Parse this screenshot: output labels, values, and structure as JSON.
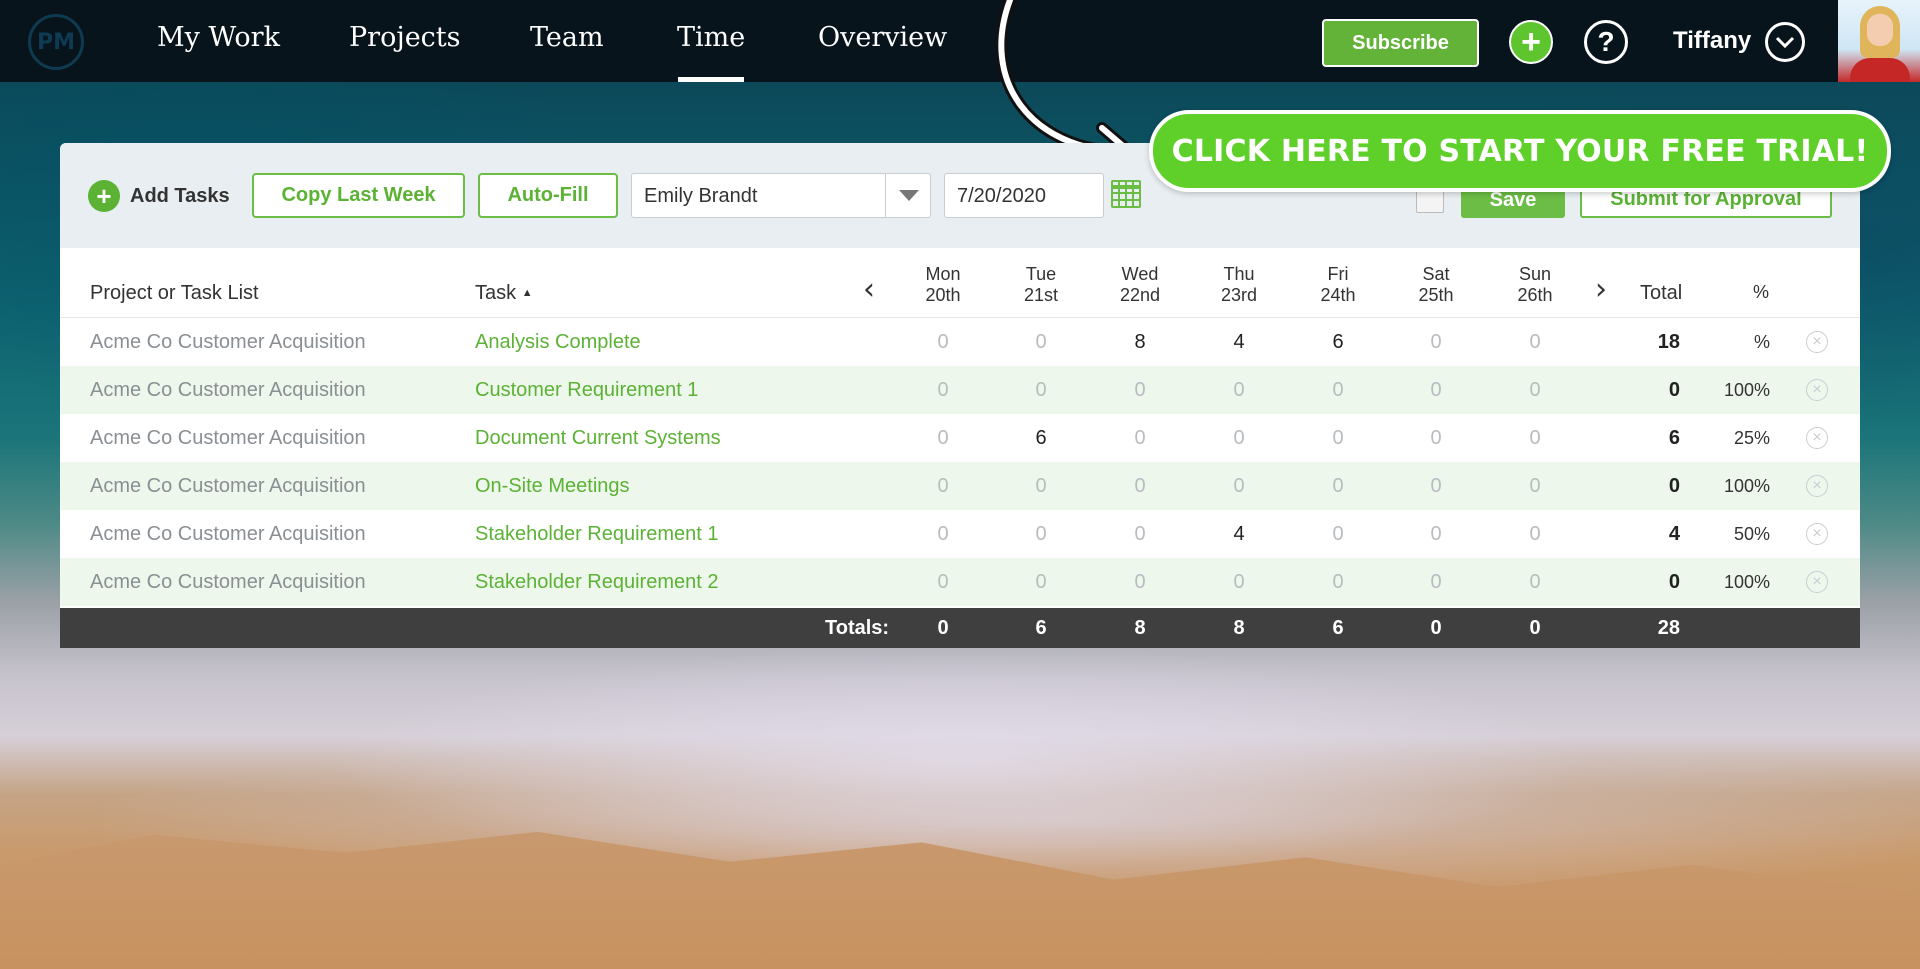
{
  "nav": {
    "logo": "PM",
    "links": [
      "My Work",
      "Projects",
      "Team",
      "Time",
      "Overview"
    ],
    "active": "Time",
    "subscribe": "Subscribe",
    "add_icon": "+",
    "help_icon": "?",
    "user": "Tiffany",
    "chevron": "⌄"
  },
  "cta": {
    "label": "CLICK HERE TO START YOUR FREE TRIAL!"
  },
  "toolbar": {
    "add_tasks": "Add Tasks",
    "add_plus": "+",
    "copy_last_week": "Copy Last Week",
    "auto_fill": "Auto-Fill",
    "person_select": "Emily Brandt",
    "date": "7/20/2020",
    "save": "Save",
    "submit": "Submit for Approval"
  },
  "table": {
    "headers": {
      "project": "Project or Task List",
      "task": "Task",
      "sort_icon": "▲",
      "prev": "‹",
      "next": "›",
      "total": "Total",
      "pct": "%"
    },
    "days": [
      {
        "dow": "Mon",
        "date": "20th"
      },
      {
        "dow": "Tue",
        "date": "21st"
      },
      {
        "dow": "Wed",
        "date": "22nd"
      },
      {
        "dow": "Thu",
        "date": "23rd"
      },
      {
        "dow": "Fri",
        "date": "24th"
      },
      {
        "dow": "Sat",
        "date": "25th"
      },
      {
        "dow": "Sun",
        "date": "26th"
      }
    ],
    "rows": [
      {
        "project": "Acme Co Customer Acquisition",
        "task": "Analysis Complete",
        "hours": [
          "0",
          "0",
          "8",
          "4",
          "6",
          "0",
          "0"
        ],
        "total": "18",
        "pct": "%"
      },
      {
        "project": "Acme Co Customer Acquisition",
        "task": "Customer Requirement 1",
        "hours": [
          "0",
          "0",
          "0",
          "0",
          "0",
          "0",
          "0"
        ],
        "total": "0",
        "pct": "100%"
      },
      {
        "project": "Acme Co Customer Acquisition",
        "task": "Document Current Systems",
        "hours": [
          "0",
          "6",
          "0",
          "0",
          "0",
          "0",
          "0"
        ],
        "total": "6",
        "pct": "25%"
      },
      {
        "project": "Acme Co Customer Acquisition",
        "task": "On-Site Meetings",
        "hours": [
          "0",
          "0",
          "0",
          "0",
          "0",
          "0",
          "0"
        ],
        "total": "0",
        "pct": "100%"
      },
      {
        "project": "Acme Co Customer Acquisition",
        "task": "Stakeholder Requirement 1",
        "hours": [
          "0",
          "0",
          "0",
          "4",
          "0",
          "0",
          "0"
        ],
        "total": "4",
        "pct": "50%"
      },
      {
        "project": "Acme Co Customer Acquisition",
        "task": "Stakeholder Requirement 2",
        "hours": [
          "0",
          "0",
          "0",
          "0",
          "0",
          "0",
          "0"
        ],
        "total": "0",
        "pct": "100%"
      }
    ],
    "delete_icon": "×",
    "totals": {
      "label": "Totals:",
      "days": [
        "0",
        "6",
        "8",
        "8",
        "6",
        "0",
        "0"
      ],
      "grand": "28"
    }
  },
  "colors": {
    "accent_green": "#5bb235",
    "cta_green": "#5fd02a",
    "nav_bg": "#07141c",
    "totals_bg": "#3f3f3f"
  }
}
